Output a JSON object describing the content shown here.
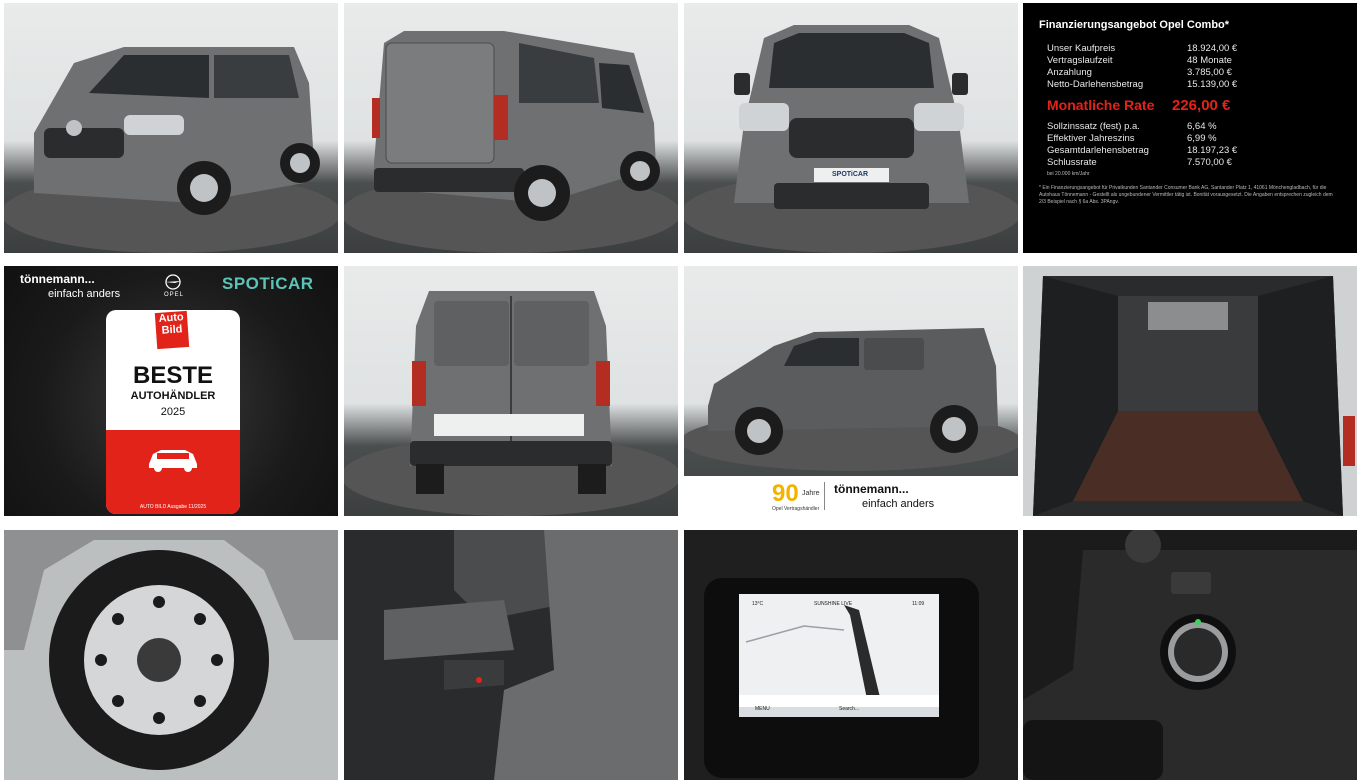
{
  "finance": {
    "title": "Finanzierungsangebot Opel Combo*",
    "rows_top": [
      {
        "label": "Unser Kaufpreis",
        "value": "18.924,00 €"
      },
      {
        "label": "Vertragslaufzeit",
        "value": "48 Monate"
      },
      {
        "label": "Anzahlung",
        "value": "3.785,00 €"
      },
      {
        "label": "Netto-Darlehensbetrag",
        "value": "15.139,00 €"
      }
    ],
    "rate_label": "Monatliche Rate",
    "rate_value": "226,00 €",
    "rows_bottom": [
      {
        "label": "Sollzinssatz (fest) p.a.",
        "value": "6,64 %"
      },
      {
        "label": "Effektiver Jahreszins",
        "value": "6,99 %"
      },
      {
        "label": "Gesamtdarlehensbetrag",
        "value": "18.197,23 €"
      },
      {
        "label": "Schlussrate",
        "value": "7.570,00 €"
      }
    ],
    "mileage_note": "bei 20.000 km/Jahr",
    "footnote": "* Ein Finanzierungsangebot für Privatkunden Santander Consumer Bank AG, Santander Platz 1, 41061 Mönchengladbach, für die Autohaus Tönnemann - Gestellt als ungebundener Vermittler tätig ist. Bonität vorausgesetzt. Die Angaben entsprechen zugleich dem 2/3 Beispiel nach § 6a Abs. 3PAngv."
  },
  "award": {
    "dealer": "tönnemann...",
    "slogan": "einfach anders",
    "brand": "OPEL",
    "spoticar": "SPOTiCAR",
    "magazine": "Auto Bild",
    "headline": "BESTE",
    "sub": "AUTOHÄNDLER",
    "year": "2025",
    "issue": "AUTO BILD Ausgabe 11/2025"
  },
  "footer": {
    "ninety": "90",
    "jahre": "Jahre",
    "vp": "Opel Vertragshändler",
    "dealer": "tönnemann...",
    "slogan": "einfach anders"
  },
  "front_plate": "SPOTiCAR",
  "screen": {
    "temp": "13°C",
    "station": "SUNSHINE LIVE",
    "time": "11:09",
    "menu": "MENU",
    "search": "Search..."
  },
  "colors": {
    "rate_red": "#e2231a",
    "spoticar_teal": "#5bc4b7",
    "van_grey": "#6e7072",
    "ninety_gold": "#f0b400"
  }
}
